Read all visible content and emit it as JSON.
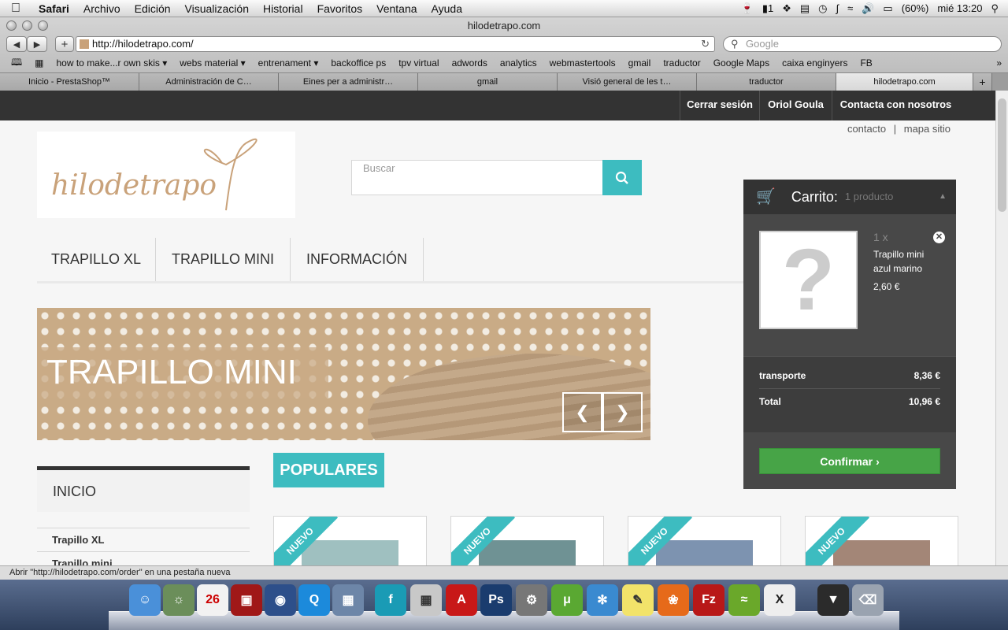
{
  "menubar": {
    "items": [
      "Safari",
      "Archivo",
      "Edición",
      "Visualización",
      "Historial",
      "Favoritos",
      "Ventana",
      "Ayuda"
    ],
    "status": {
      "spaces": "1",
      "battery": "(60%)",
      "clock": "mié 13:20"
    }
  },
  "browser": {
    "title": "hilodetrapo.com",
    "url": "http://hilodetrapo.com/",
    "search_placeholder": "Google",
    "bookmarks": [
      "how to make...r own skis ▾",
      "webs material ▾",
      "entrenament ▾",
      "backoffice ps",
      "tpv virtual",
      "adwords",
      "analytics",
      "webmastertools",
      "gmail",
      "traductor",
      "Google Maps",
      "caixa enginyers",
      "FB"
    ],
    "tabs": [
      "Inicio - PrestaShop™",
      "Administración de C…",
      "Eines per a administr…",
      "gmail",
      "Visió general de les t…",
      "traductor",
      "hilodetrapo.com"
    ],
    "status_text": "Abrir \"http://hilodetrapo.com/order\" en una pestaña nueva"
  },
  "site": {
    "topbar": [
      "Cerrar sesión",
      "Oriol Goula",
      "Contacta con nosotros"
    ],
    "sublinks": {
      "contact": "contacto",
      "sep": "|",
      "sitemap": "mapa sitio"
    },
    "logo_text": "hilodetrapo",
    "search_placeholder": "Buscar",
    "nav": [
      "TRAPILLO XL",
      "TRAPILLO MINI",
      "INFORMACIÓN"
    ],
    "banner_text": "TRAPILLO MINI",
    "populares": "POPULARES",
    "sidebar": {
      "heading": "INICIO",
      "items": [
        "Trapillo XL",
        "Trapillo mini"
      ]
    },
    "ribbon": "NUEVO",
    "products_visible": 4
  },
  "cart": {
    "title": "Carrito:",
    "count": "1 producto",
    "item": {
      "qty": "1 x",
      "name": "Trapillo mini azul marino",
      "price": "2,60 €",
      "image_placeholder": "?"
    },
    "shipping_label": "transporte",
    "shipping_value": "8,36 €",
    "total_label": "Total",
    "total_value": "10,96 €",
    "confirm": "Confirmar"
  },
  "dock": {
    "calendar_day": "26",
    "apps": [
      "Finder",
      "iPhoto",
      "iCal",
      "Photo Booth",
      "DVD Player",
      "QuickTime",
      "Preview",
      "Flash",
      "Calculator",
      "Acrobat",
      "Photoshop",
      "System Preferences",
      "uTorrent",
      "Safari",
      "Stickies",
      "Firefox",
      "FileZilla",
      "Spotify",
      "X11",
      "Downloads",
      "Trash"
    ]
  },
  "colors": {
    "accent": "#3dbcc0",
    "topbar": "#333333",
    "cart": "#484848",
    "confirm": "#47a447"
  }
}
